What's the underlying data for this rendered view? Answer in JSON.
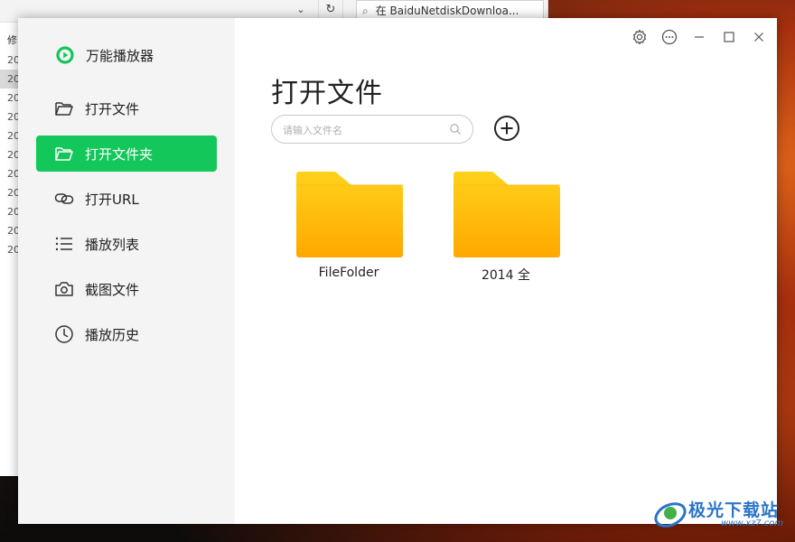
{
  "background_window": {
    "dropdown_glyph": "⌄",
    "refresh_glyph": "↻",
    "search_text": "在 BaiduNetdiskDownloa...",
    "column_header": "修",
    "rows": [
      "20",
      "20",
      "20",
      "20",
      "20",
      "20",
      "20",
      "20",
      "20",
      "20",
      "20"
    ]
  },
  "app": {
    "name": "万能播放器",
    "accent_color": "#13c75a",
    "nav": [
      {
        "label": "打开文件",
        "icon": "folder-open-icon"
      },
      {
        "label": "打开文件夹",
        "icon": "folder-open-icon",
        "active": true
      },
      {
        "label": "打开URL",
        "icon": "link-icon"
      },
      {
        "label": "播放列表",
        "icon": "list-icon"
      },
      {
        "label": "截图文件",
        "icon": "camera-icon"
      },
      {
        "label": "播放历史",
        "icon": "clock-icon"
      }
    ],
    "window_controls": [
      "gear-icon",
      "more-icon",
      "minimize-icon",
      "maximize-icon",
      "close-icon"
    ]
  },
  "main": {
    "title": "打开文件",
    "search": {
      "placeholder": "请输入文件名",
      "value": ""
    },
    "folders": [
      {
        "name": "FileFolder",
        "icon": "folder-icon"
      },
      {
        "name": "2014 全",
        "icon": "folder-icon"
      }
    ]
  },
  "watermark": {
    "text": "极光下载站",
    "url": "www.xz7.com"
  }
}
